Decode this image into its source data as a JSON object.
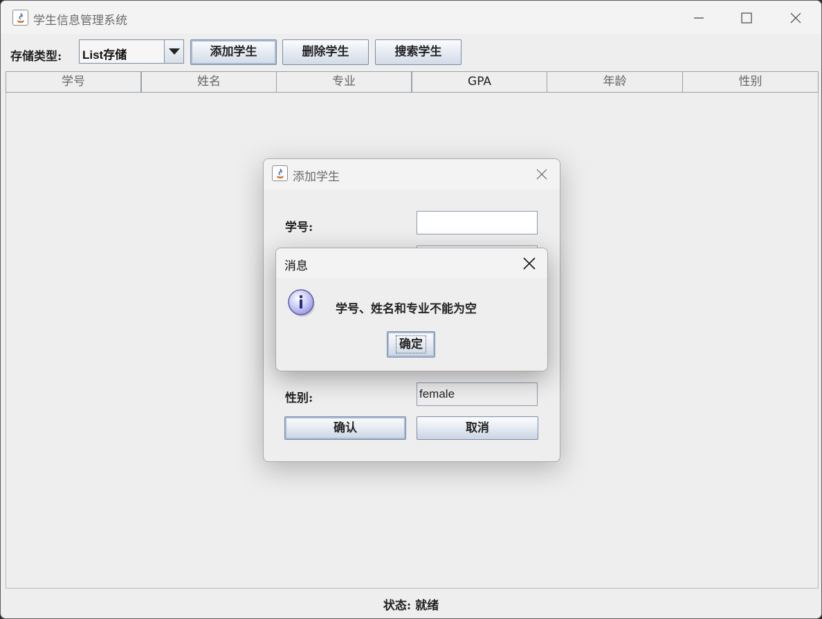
{
  "window": {
    "title": "学生信息管理系统",
    "minimize_icon": "minimize-icon",
    "maximize_icon": "maximize-icon",
    "close_icon": "close-icon"
  },
  "toolbar": {
    "storage_label": "存储类型:",
    "storage_value": "List存储",
    "add_label": "添加学生",
    "delete_label": "删除学生",
    "search_label": "搜索学生"
  },
  "table": {
    "columns": [
      "学号",
      "姓名",
      "专业",
      "GPA",
      "年龄",
      "性别"
    ],
    "rows": []
  },
  "status": {
    "text": "状态: 就绪"
  },
  "add_dialog": {
    "title": "添加学生",
    "fields": {
      "id_label": "学号:",
      "id_value": "",
      "gender_label": "性别:",
      "gender_value": "female"
    },
    "confirm_label": "确认",
    "cancel_label": "取消"
  },
  "message_dialog": {
    "title": "消息",
    "icon": "info-icon",
    "text": "学号、姓名和专业不能为空",
    "ok_label": "确定"
  },
  "colors": {
    "button_border": "#7a8ca5",
    "accent_focus": "#a6bbd6",
    "info_icon": "#b8b8f0"
  }
}
